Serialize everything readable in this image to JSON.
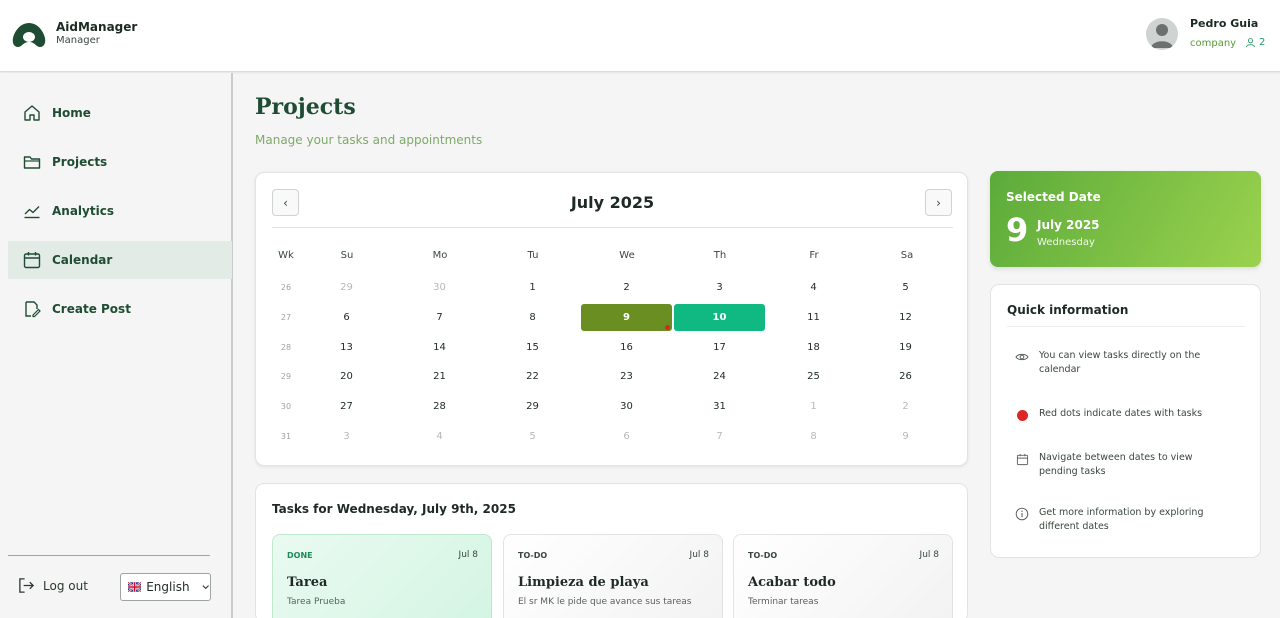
{
  "header": {
    "brand_name": "AidManager",
    "brand_sub": "Manager",
    "user_name": "Pedro Guia",
    "user_role": "company",
    "user_count": "2"
  },
  "sidebar": {
    "items": [
      {
        "label": "Home",
        "icon": "home-icon"
      },
      {
        "label": "Projects",
        "icon": "folder-icon"
      },
      {
        "label": "Analytics",
        "icon": "chart-line-icon"
      },
      {
        "label": "Calendar",
        "icon": "calendar-icon",
        "active": true
      },
      {
        "label": "Create Post",
        "icon": "edit-post-icon"
      }
    ],
    "logout_label": "Log out",
    "language": "English"
  },
  "page": {
    "title": "Projects",
    "subtitle": "Manage your tasks and appointments"
  },
  "calendar": {
    "month_title": "July 2025",
    "prev_label": "‹",
    "next_label": "›",
    "headers": [
      "Wk",
      "Su",
      "Mo",
      "Tu",
      "We",
      "Th",
      "Fr",
      "Sa"
    ],
    "weeks": [
      {
        "wk": "26",
        "days": [
          {
            "d": "29",
            "m": true
          },
          {
            "d": "30",
            "m": true
          },
          {
            "d": "1"
          },
          {
            "d": "2"
          },
          {
            "d": "3"
          },
          {
            "d": "4"
          },
          {
            "d": "5"
          }
        ]
      },
      {
        "wk": "27",
        "days": [
          {
            "d": "6"
          },
          {
            "d": "7"
          },
          {
            "d": "8"
          },
          {
            "d": "9",
            "sel": true,
            "dot": true
          },
          {
            "d": "10",
            "today": true
          },
          {
            "d": "11"
          },
          {
            "d": "12"
          }
        ]
      },
      {
        "wk": "28",
        "days": [
          {
            "d": "13"
          },
          {
            "d": "14"
          },
          {
            "d": "15"
          },
          {
            "d": "16"
          },
          {
            "d": "17"
          },
          {
            "d": "18"
          },
          {
            "d": "19"
          }
        ]
      },
      {
        "wk": "29",
        "days": [
          {
            "d": "20"
          },
          {
            "d": "21"
          },
          {
            "d": "22"
          },
          {
            "d": "23"
          },
          {
            "d": "24"
          },
          {
            "d": "25"
          },
          {
            "d": "26"
          }
        ]
      },
      {
        "wk": "30",
        "days": [
          {
            "d": "27"
          },
          {
            "d": "28"
          },
          {
            "d": "29"
          },
          {
            "d": "30"
          },
          {
            "d": "31"
          },
          {
            "d": "1",
            "m": true
          },
          {
            "d": "2",
            "m": true
          }
        ]
      },
      {
        "wk": "31",
        "days": [
          {
            "d": "3",
            "m": true
          },
          {
            "d": "4",
            "m": true
          },
          {
            "d": "5",
            "m": true
          },
          {
            "d": "6",
            "m": true
          },
          {
            "d": "7",
            "m": true
          },
          {
            "d": "8",
            "m": true
          },
          {
            "d": "9",
            "m": true
          }
        ]
      }
    ]
  },
  "tasks": {
    "title": "Tasks for Wednesday, July 9th, 2025",
    "items": [
      {
        "status": "DONE",
        "date": "Jul 8",
        "name": "Tarea",
        "desc": "Tarea Prueba",
        "kind": "done"
      },
      {
        "status": "TO-DO",
        "date": "Jul 8",
        "name": "Limpieza de playa",
        "desc": "El sr MK le pide que avance sus tareas",
        "kind": "todo"
      },
      {
        "status": "TO-DO",
        "date": "Jul 8",
        "name": "Acabar todo",
        "desc": "Terminar tareas",
        "kind": "todo"
      }
    ]
  },
  "selected_date": {
    "label": "Selected Date",
    "day": "9",
    "month": "July 2025",
    "weekday": "Wednesday"
  },
  "quick_info": {
    "title": "Quick information",
    "items": [
      {
        "icon": "eye-icon",
        "text": "You can view tasks directly on the calendar"
      },
      {
        "icon": "red-dot-icon",
        "text": "Red dots indicate dates with tasks"
      },
      {
        "icon": "calendar-small-icon",
        "text": "Navigate between dates to view pending tasks"
      },
      {
        "icon": "info-icon",
        "text": "Get more information by exploring different dates"
      }
    ]
  },
  "colors": {
    "primary": "#1f4d34",
    "selected_day": "#6b8e23",
    "today": "#10b981",
    "task_dot": "#dc2626"
  }
}
